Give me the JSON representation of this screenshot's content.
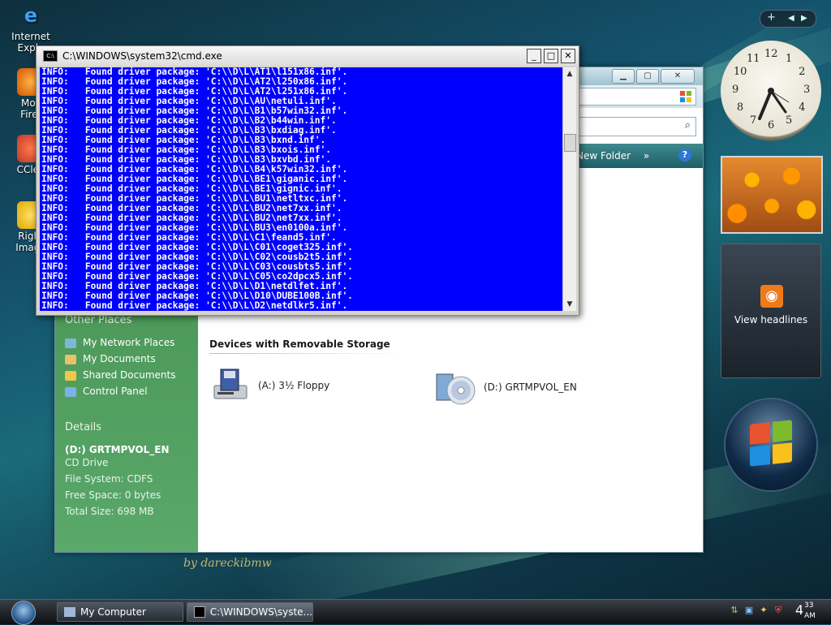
{
  "desktop": {
    "icons": [
      {
        "label": "Internet\nExplo",
        "icon": "internet-explorer-icon"
      },
      {
        "label": "Moz\nFiref",
        "icon": "firefox-icon"
      },
      {
        "label": "CClea",
        "icon": "ccleaner-icon"
      },
      {
        "label": "Right\nImage",
        "icon": "image-resizer-icon"
      }
    ],
    "signature": "by dareckibmw"
  },
  "explorer": {
    "toolbar_item": "New Folder",
    "toolbar_more": "»",
    "help": "?",
    "other_places_title": "Other Places",
    "other_places": [
      "My Network Places",
      "My Documents",
      "Shared Documents",
      "Control Panel"
    ],
    "details_title": "Details",
    "details_name": "(D:) GRTMPVOL_EN",
    "details_lines": [
      "CD Drive",
      "File System: CDFS",
      "Free Space: 0 bytes",
      "Total Size: 698 MB"
    ],
    "group_header": "Devices with Removable Storage",
    "drives": [
      {
        "label": "(A:) 3½ Floppy",
        "icon": "floppy-drive-icon"
      },
      {
        "label": "(D:) GRTMPVOL_EN",
        "icon": "cd-drive-icon"
      }
    ]
  },
  "cmd": {
    "title": "C:\\WINDOWS\\system32\\cmd.exe",
    "lines": [
      "INFO:   Found driver package: 'C:\\\\D\\L\\AT1\\l151x86.inf'.",
      "INFO:   Found driver package: 'C:\\\\D\\L\\AT2\\l250x86.inf'.",
      "INFO:   Found driver package: 'C:\\\\D\\L\\AT2\\l251x86.inf'.",
      "INFO:   Found driver package: 'C:\\\\D\\L\\AU\\netuli.inf'.",
      "INFO:   Found driver package: 'C:\\\\D\\L\\B1\\b57win32.inf'.",
      "INFO:   Found driver package: 'C:\\\\D\\L\\B2\\b44win.inf'.",
      "INFO:   Found driver package: 'C:\\\\D\\L\\B3\\bxdiag.inf'.",
      "INFO:   Found driver package: 'C:\\\\D\\L\\B3\\bxnd.inf'.",
      "INFO:   Found driver package: 'C:\\\\D\\L\\B3\\bxois.inf'.",
      "INFO:   Found driver package: 'C:\\\\D\\L\\B3\\bxvbd.inf'.",
      "INFO:   Found driver package: 'C:\\\\D\\L\\B4\\k57win32.inf'.",
      "INFO:   Found driver package: 'C:\\\\D\\L\\BE1\\giganic.inf'.",
      "INFO:   Found driver package: 'C:\\\\D\\L\\BE1\\gignic.inf'.",
      "INFO:   Found driver package: 'C:\\\\D\\L\\BU1\\netltxc.inf'.",
      "INFO:   Found driver package: 'C:\\\\D\\L\\BU2\\net7xx.inf'.",
      "INFO:   Found driver package: 'C:\\\\D\\L\\BU2\\net7xx.inf'.",
      "INFO:   Found driver package: 'C:\\\\D\\L\\BU3\\en0100a.inf'.",
      "INFO:   Found driver package: 'C:\\\\D\\L\\C1\\feand5.inf'.",
      "INFO:   Found driver package: 'C:\\\\D\\L\\C01\\coget325.inf'.",
      "INFO:   Found driver package: 'C:\\\\D\\L\\C02\\cousb2t5.inf'.",
      "INFO:   Found driver package: 'C:\\\\D\\L\\C03\\cousbts5.inf'.",
      "INFO:   Found driver package: 'C:\\\\D\\L\\C05\\co2dpcx5.inf'.",
      "INFO:   Found driver package: 'C:\\\\D\\L\\D1\\netdlfet.inf'.",
      "INFO:   Found driver package: 'C:\\\\D\\L\\D10\\DUBE100B.inf'.",
      "INFO:   Found driver package: 'C:\\\\D\\L\\D2\\netdlkr5.inf'."
    ]
  },
  "sidebar": {
    "clock_numbers": [
      "12",
      "1",
      "2",
      "3",
      "4",
      "5",
      "6",
      "7",
      "8",
      "9",
      "10",
      "11"
    ],
    "feed_label": "View headlines"
  },
  "taskbar": {
    "tasks": [
      {
        "label": "My Computer",
        "icon": "my-computer-icon"
      },
      {
        "label": "C:\\WINDOWS\\syste...",
        "icon": "cmd-icon"
      }
    ],
    "time_hour": "4",
    "time_min": "33",
    "time_ampm": "AM"
  }
}
